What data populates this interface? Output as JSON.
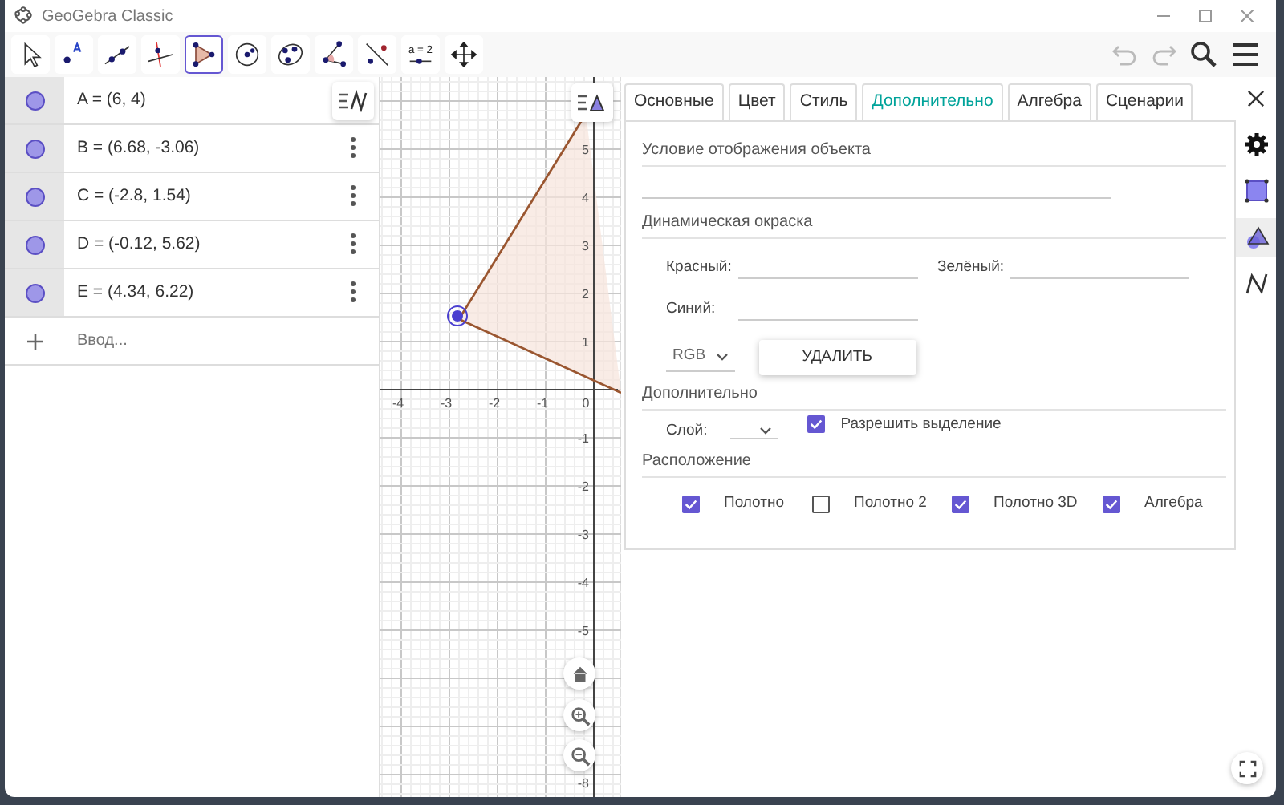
{
  "window": {
    "title": "GeoGebra Classic"
  },
  "toolbar": {
    "tools": [
      {
        "kind": "move",
        "selected": false
      },
      {
        "kind": "point",
        "selected": false
      },
      {
        "kind": "line",
        "selected": false
      },
      {
        "kind": "perpendicular",
        "selected": false
      },
      {
        "kind": "polygon",
        "selected": true
      },
      {
        "kind": "circle",
        "selected": false
      },
      {
        "kind": "conic",
        "selected": false
      },
      {
        "kind": "angle",
        "selected": false
      },
      {
        "kind": "reflect",
        "selected": false
      },
      {
        "kind": "slider",
        "selected": false,
        "label": "a = 2"
      },
      {
        "kind": "pan",
        "selected": false
      }
    ]
  },
  "algebra": {
    "items": [
      {
        "text": "A = (6, 4)",
        "visible": true,
        "menu": false
      },
      {
        "text": "B = (6.68, -3.06)",
        "visible": true,
        "menu": true
      },
      {
        "text": "C = (-2.8, 1.54)",
        "visible": true,
        "menu": true
      },
      {
        "text": "D = (-0.12, 5.62)",
        "visible": true,
        "menu": true
      },
      {
        "text": "E = (4.34, 6.22)",
        "visible": true,
        "menu": true
      }
    ],
    "input": {
      "placeholder": "Ввод..."
    }
  },
  "graphics": {
    "x_ticks": [
      "-4",
      "-3",
      "-2",
      "-1",
      "0"
    ],
    "y_ticks": [
      "5",
      "4",
      "3",
      "2",
      "1",
      "-1",
      "-2",
      "-3",
      "-4",
      "-5",
      "-8"
    ]
  },
  "properties": {
    "tabs": [
      {
        "label": "Основные",
        "selected": false
      },
      {
        "label": "Цвет",
        "selected": false
      },
      {
        "label": "Стиль",
        "selected": false
      },
      {
        "label": "Дополнительно",
        "selected": true
      },
      {
        "label": "Алгебра",
        "selected": false
      },
      {
        "label": "Сценарии",
        "selected": false
      }
    ],
    "condition": {
      "title": "Условие отображения объекта"
    },
    "dynamic_colors": {
      "title": "Динамическая окраска",
      "fields": [
        {
          "label": "Красный:"
        },
        {
          "label": "Зелёный:"
        },
        {
          "label": "Синий:"
        }
      ],
      "mode": "RGB",
      "button": "УДАЛИТЬ"
    },
    "advanced": {
      "title": "Дополнительно",
      "layer_label": "Слой:",
      "selection": {
        "label": "Разрешить выделение",
        "checked": true
      }
    },
    "location": {
      "title": "Расположение",
      "views": [
        {
          "label": "Полотно",
          "checked": true
        },
        {
          "label": "Полотно 2",
          "checked": false
        },
        {
          "label": "Полотно 3D",
          "checked": true
        },
        {
          "label": "Алгебра",
          "checked": true
        }
      ]
    }
  },
  "side_icons": [
    {
      "kind": "settings",
      "selected": false
    },
    {
      "kind": "graphics",
      "selected": false
    },
    {
      "kind": "shapes",
      "selected": true
    },
    {
      "kind": "algebra",
      "selected": false
    }
  ]
}
